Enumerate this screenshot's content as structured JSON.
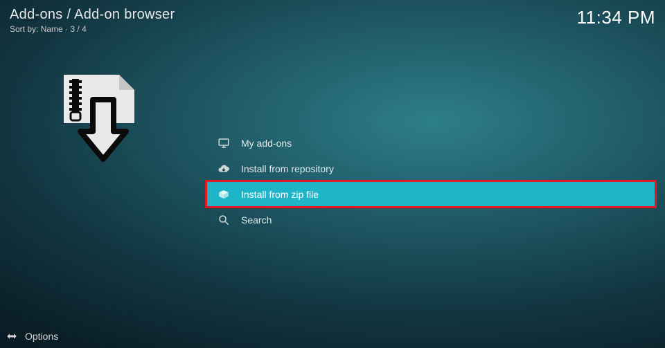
{
  "header": {
    "breadcrumb": "Add-ons / Add-on browser",
    "sort_prefix": "Sort by: ",
    "sort_field": "Name",
    "position": "3 / 4",
    "clock": "11:34 PM"
  },
  "menu": {
    "items": [
      {
        "label": "My add-ons",
        "icon": "monitor-icon",
        "selected": false
      },
      {
        "label": "Install from repository",
        "icon": "cloud-download-icon",
        "selected": false
      },
      {
        "label": "Install from zip file",
        "icon": "open-box-icon",
        "selected": true
      },
      {
        "label": "Search",
        "icon": "search-icon",
        "selected": false
      }
    ]
  },
  "footer": {
    "options_label": "Options"
  }
}
